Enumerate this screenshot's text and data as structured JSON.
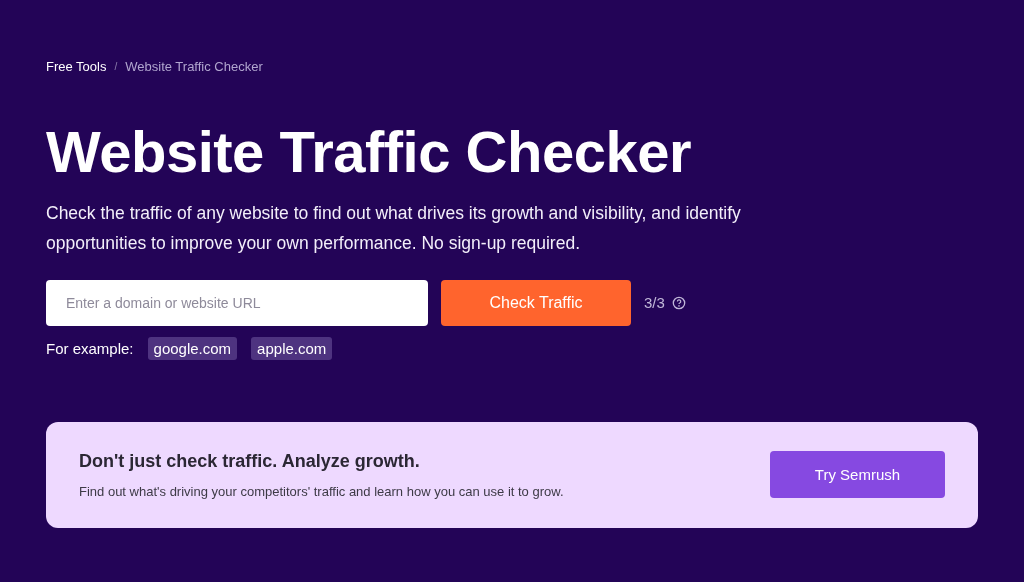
{
  "breadcrumb": [
    {
      "label": "Free Tools",
      "kind": "link"
    },
    {
      "label": "/",
      "kind": "separator"
    },
    {
      "label": "Website Traffic Checker",
      "kind": "current"
    }
  ],
  "title": "Website Traffic Checker",
  "description": "Check the traffic of any website to find out what drives its growth and visibility, and identify opportunities to improve your own performance. No sign-up required.",
  "search": {
    "placeholder": "Enter a domain or website URL",
    "button": "Check Traffic",
    "counter": "3/3"
  },
  "examples": {
    "label": "For example:",
    "items": [
      "google.com",
      "apple.com"
    ]
  },
  "promo": {
    "title": "Don't just check traffic. Analyze growth.",
    "text": "Find out what's driving your competitors' traffic and learn how you can use it to grow.",
    "button": "Try Semrush"
  }
}
